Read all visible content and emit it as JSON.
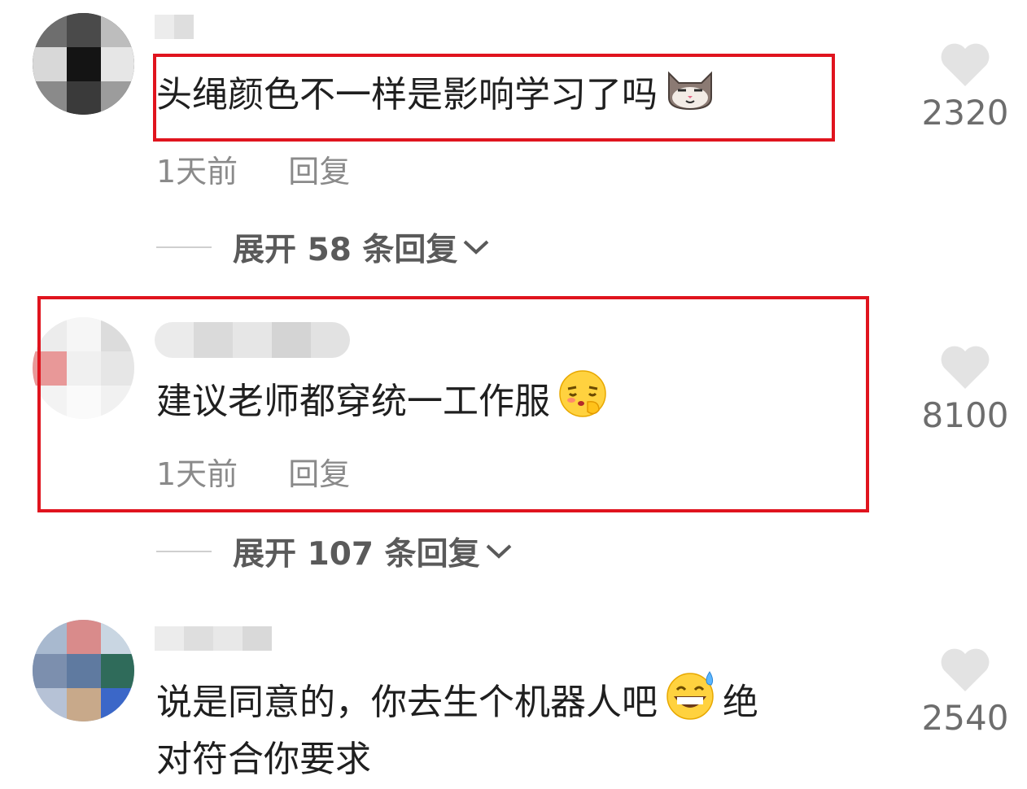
{
  "comments": [
    {
      "text": "头绳颜色不一样是影响学习了吗",
      "time": "1天前",
      "reply_label": "回复",
      "likes": "2320",
      "expand_label": "展开 58 条回复",
      "emoji": "cat-face-icon"
    },
    {
      "text": "建议老师都穿统一工作服",
      "time": "1天前",
      "reply_label": "回复",
      "likes": "8100",
      "expand_label": "展开 107 条回复",
      "emoji": "shushing-face-icon"
    },
    {
      "text_line1": "说是同意的，你去生个机器人吧",
      "text_after_emoji": "绝",
      "text_line2": "对符合你要求",
      "likes": "2540",
      "emoji": "grinning-sweat-face-icon"
    }
  ],
  "colors": {
    "highlight_border": "#e0141e",
    "meta_text": "#8a8a8a",
    "heart": "#e3e3e3"
  }
}
